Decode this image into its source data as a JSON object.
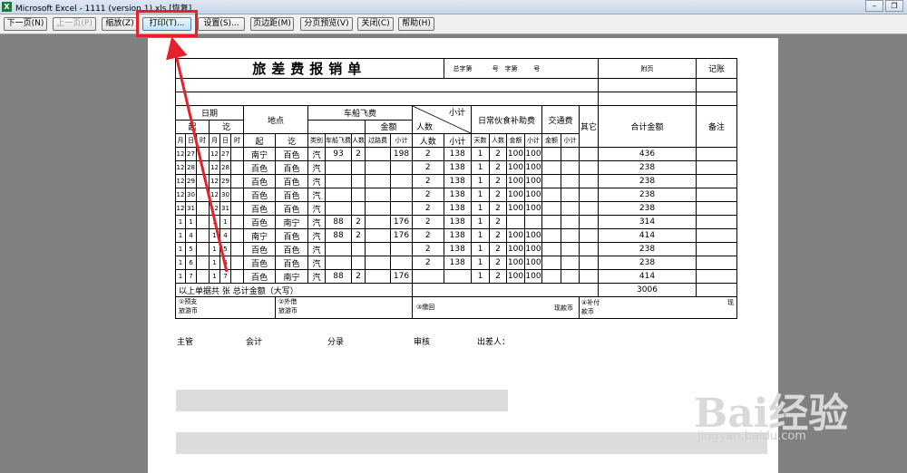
{
  "window": {
    "title": "Microsoft Excel - 1111 (version 1).xls  [恢复]",
    "app_icon": "X"
  },
  "toolbar": {
    "buttons": [
      {
        "label": "下一页(N)",
        "enabled": true
      },
      {
        "label": "上一页(P)",
        "enabled": false
      },
      {
        "label": "缩放(Z)",
        "enabled": true
      },
      {
        "label": "打印(T)...",
        "enabled": true
      },
      {
        "label": "设置(S)...",
        "enabled": true
      },
      {
        "label": "页边距(M)",
        "enabled": true
      },
      {
        "label": "分页预览(V)",
        "enabled": true
      },
      {
        "label": "关闭(C)",
        "enabled": true
      },
      {
        "label": "帮助(H)",
        "enabled": true
      }
    ]
  },
  "form": {
    "title": "旅差费报销单",
    "header_right": {
      "zong_zi": "总字第",
      "hao1": "号",
      "zi_di": "字第",
      "hao2": "号",
      "fu_ye": "附页",
      "ji_zhang": "记账"
    },
    "headers": {
      "date": "日期",
      "qi": "起",
      "qi2": "讫",
      "place": "地点",
      "travel": "车船飞费",
      "amount": "金额",
      "subtotal": "小计",
      "people": "人数",
      "daily": "日常伙食补助费",
      "transport": "交通费",
      "other": "其它",
      "total": "合计金额",
      "remark": "备注",
      "month": "月",
      "day": "日",
      "hour": "时",
      "place_from": "起",
      "place_to": "讫",
      "category": "类别",
      "fare": "车船飞费",
      "fare_people": "人数",
      "toll": "过路费",
      "days": "天数",
      "amt": "金额"
    },
    "rows": [
      [
        "12",
        "27",
        "",
        "12",
        "27",
        "",
        "南宁",
        "百色",
        "汽",
        "93",
        "2",
        "",
        "198",
        "2",
        "138",
        "1",
        "2",
        "100",
        "100",
        "",
        "",
        "",
        "436"
      ],
      [
        "12",
        "28",
        "",
        "12",
        "28",
        "",
        "百色",
        "百色",
        "汽",
        "",
        "",
        "",
        "",
        "2",
        "138",
        "1",
        "2",
        "100",
        "100",
        "",
        "",
        "",
        "238"
      ],
      [
        "12",
        "29",
        "",
        "12",
        "29",
        "",
        "百色",
        "百色",
        "汽",
        "",
        "",
        "",
        "",
        "2",
        "138",
        "1",
        "2",
        "100",
        "100",
        "",
        "",
        "",
        "238"
      ],
      [
        "12",
        "30",
        "",
        "12",
        "30",
        "",
        "百色",
        "百色",
        "汽",
        "",
        "",
        "",
        "",
        "2",
        "138",
        "1",
        "2",
        "100",
        "100",
        "",
        "",
        "",
        "238"
      ],
      [
        "12",
        "31",
        "",
        "12",
        "31",
        "",
        "百色",
        "百色",
        "汽",
        "",
        "",
        "",
        "",
        "2",
        "138",
        "1",
        "2",
        "100",
        "100",
        "",
        "",
        "",
        "238"
      ],
      [
        "1",
        "1",
        "",
        "1",
        "1",
        "",
        "百色",
        "南宁",
        "汽",
        "88",
        "2",
        "",
        "176",
        "2",
        "138",
        "1",
        "2",
        "",
        "",
        "",
        "",
        "",
        "314"
      ],
      [
        "1",
        "4",
        "",
        "1",
        "4",
        "",
        "南宁",
        "百色",
        "汽",
        "88",
        "2",
        "",
        "176",
        "2",
        "138",
        "1",
        "2",
        "100",
        "100",
        "",
        "",
        "",
        "414"
      ],
      [
        "1",
        "5",
        "",
        "1",
        "5",
        "",
        "百色",
        "百色",
        "汽",
        "",
        "",
        "",
        "",
        "2",
        "138",
        "1",
        "2",
        "100",
        "100",
        "",
        "",
        "",
        "238"
      ],
      [
        "1",
        "6",
        "",
        "1",
        "6",
        "",
        "百色",
        "百色",
        "汽",
        "",
        "",
        "",
        "",
        "2",
        "138",
        "1",
        "2",
        "100",
        "100",
        "",
        "",
        "",
        "238"
      ],
      [
        "1",
        "7",
        "",
        "1",
        "7",
        "",
        "百色",
        "南宁",
        "汽",
        "88",
        "2",
        "",
        "176",
        "",
        "",
        "1",
        "2",
        "100",
        "100",
        "",
        "",
        "",
        "414"
      ]
    ],
    "summary": {
      "text": "以上单据共          张     总计金额（大写）",
      "total": "3006"
    },
    "footer": {
      "advance": "①预支\n旅游币",
      "return": "②外借\n旅游币",
      "refund": "③缴回",
      "cash": "现款币",
      "supplement": "④补付\n款币",
      "cash2": "现"
    },
    "signatures": [
      "主管",
      "会计",
      "分录",
      "审核",
      "出差人："
    ]
  },
  "watermark": {
    "logo": "Bai经验",
    "url": "jingyan.baidu.com"
  }
}
